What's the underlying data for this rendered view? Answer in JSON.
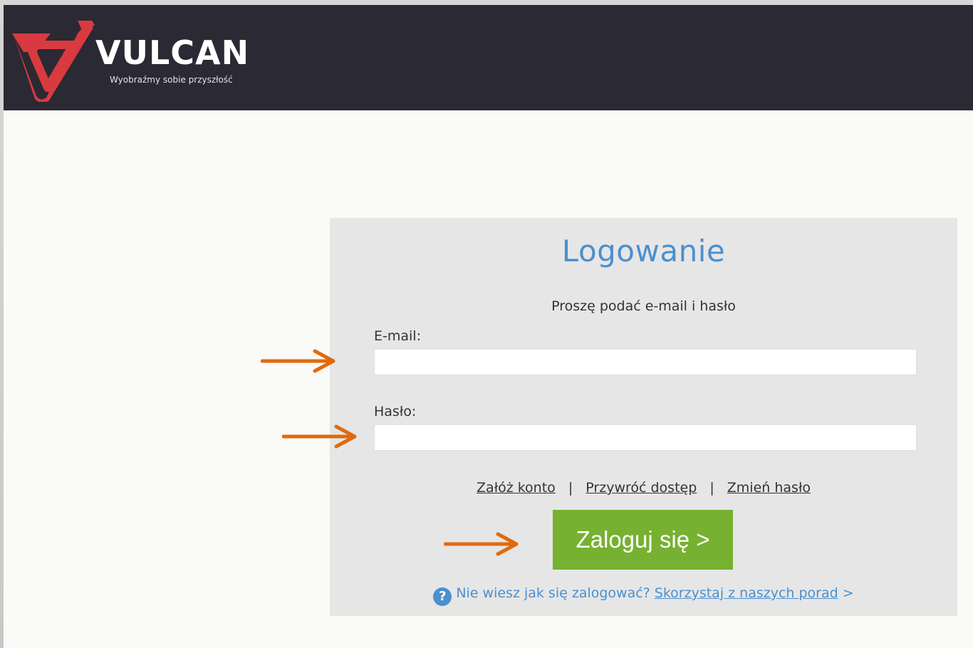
{
  "brand": {
    "name": "VULCAN",
    "tagline": "Wyobraźmy sobie przyszłość"
  },
  "login": {
    "title": "Logowanie",
    "subtitle": "Proszę podać e-mail i hasło",
    "email_label": "E-mail:",
    "email_value": "",
    "password_label": "Hasło:",
    "password_value": "",
    "links": {
      "create_account": "Załóż konto",
      "separator": "|",
      "restore_access": "Przywróć dostęp",
      "change_password": "Zmień hasło"
    },
    "submit_label": "Zaloguj się >",
    "help": {
      "icon": "?",
      "question": "Nie wiesz jak się zalogować?",
      "link": "Skorzystaj z naszych porad",
      "chevron": ">"
    }
  },
  "colors": {
    "header_bg": "#2b2933",
    "accent_blue": "#4a90cf",
    "button_green": "#76b131",
    "arrow_orange": "#e06a0e",
    "logo_red": "#d93a3f"
  }
}
